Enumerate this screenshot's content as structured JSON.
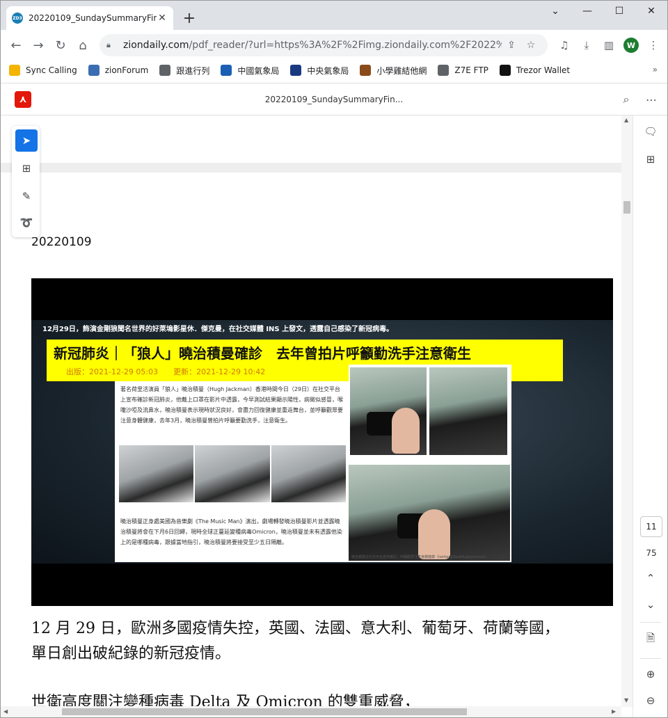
{
  "browser": {
    "tab_title": "20220109_SundaySummaryFin",
    "favicon_text": "ZD3",
    "url_host": "ziondaily.com",
    "url_path": "/pdf_reader/?url=https%3A%2F%2Fimg.ziondaily.com%2F2022%2...",
    "avatar_letter": "W",
    "icons": [
      "back-icon",
      "forward-icon",
      "reload-icon",
      "home-icon",
      "lock-icon",
      "share-icon",
      "star-icon",
      "media-icon",
      "download-icon",
      "sidepanel-icon",
      "menu-icon"
    ]
  },
  "bookmarks": [
    {
      "label": "Sync Calling",
      "color": "#f4b400"
    },
    {
      "label": "zionForum",
      "color": "#3b6db3"
    },
    {
      "label": "跟進行列",
      "color": "#5f6368"
    },
    {
      "label": "中國氣象局",
      "color": "#1a5fb4"
    },
    {
      "label": "中央氣象局",
      "color": "#1a3a80"
    },
    {
      "label": "小學雞結他網",
      "color": "#8a4a1a"
    },
    {
      "label": "Z7E FTP",
      "color": "#5f6368"
    },
    {
      "label": "Trezor Wallet",
      "color": "#111111"
    }
  ],
  "bookmarks_more": "»",
  "pdf": {
    "title": "20220109_SundaySummaryFin...",
    "doc_date": "20220109",
    "image": {
      "caption": "12月29日，飾演金剛狼聞名世界的好萊塢影星休．傑克曼，在社交媒體 INS 上發文，透露自己感染了新冠病毒。",
      "headline": "新冠肺炎｜「狼人」曉治積曼確診　去年曾拍片呼籲勤洗手注意衛生",
      "meta": "出版：2021-12-29 05:03　　更新：2021-12-29 10:42",
      "article_text": "著名荷里活演員「狼人」曉治積曼（Hugh Jackman）香港時間今日（29日）在社交平台上宣布確診新冠肺炎，他戴上口罩在影片中透露，今早測試結果顯示陽性，病徵似感冒，喉嚨沙啞及流鼻水，曉治積曼表示現時狀況良好，會盡力回復健康並重返舞台，並呼籲觀眾要注意身體健康，去年3月，曉治積曼曾拍片呼籲要勤洗手，注意衛生。",
      "article_text2": "曉治積曼正身處美國為音樂劇《The Music Man》演出，劇場轉發曉治積曼影片並透露曉治積曼將會在下月6日回歸，現時全球正蔓延變種病毒Omicron，曉治積曼並未有透露他染上的是哪種病毒，跟據當地指引，曉治積曼將要接受至少五日隔離。",
      "photo_credit": "曉治積曼在社交平台宣布確診，呼籲觀眾注意身體健康（twitter@RealHughJackman）"
    },
    "paragraph1_line1": "12 月 29 日，歐洲多國疫情失控，英國、法國、意大利、葡萄牙、荷蘭等國，",
    "paragraph1_line2": "單日創出破紀錄的新冠疫情。",
    "paragraph2_line1": "世衛高度關注變種病毒 Delta 及 Omicron 的雙重威脅，",
    "current_page": "11",
    "total_pages": "75"
  },
  "colors": {
    "adobe_red": "#e3170a",
    "tool_active": "#1473e6",
    "banner_yellow": "#ffff00"
  }
}
